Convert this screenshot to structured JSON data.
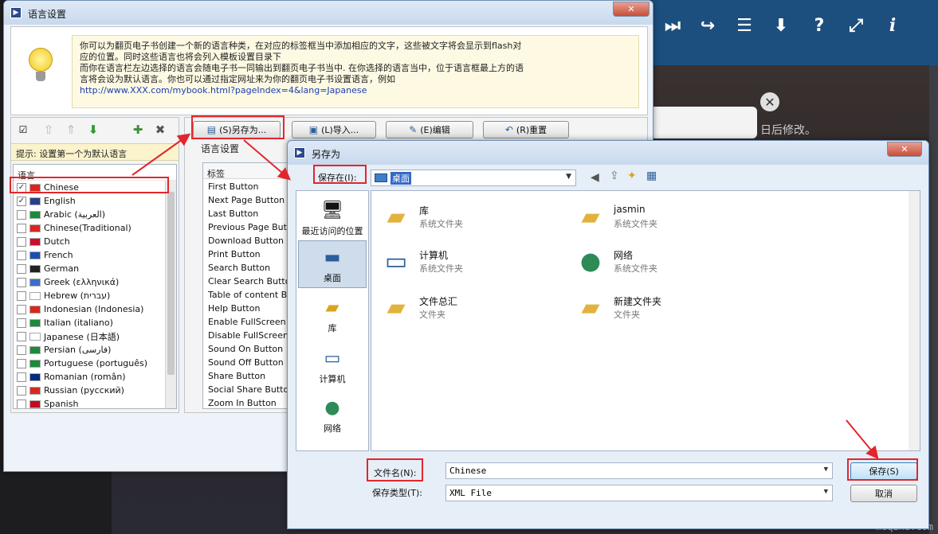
{
  "background_app": {
    "toolbar_icons": [
      "forward-icon",
      "share-icon",
      "list-icon",
      "download-icon",
      "help-icon",
      "fullscreen-icon",
      "info-icon"
    ],
    "popup_text": "日后修改。",
    "watermark": "muqina.com"
  },
  "lang_window": {
    "title": "语言设置",
    "info_text": "你可以为翻页电子书创建一个新的语言种类，在对应的标签框当中添加相应的文字，这些被文字将会显示到flash对\n应的位置。同时这些语言也将会列入模板设置目录下\n而你在语言栏左边选择的语言会随电子书一同输出到翻页电子书当中. 在你选择的语言当中，位于语言框最上方的语\n言将会设为默认语言。你也可以通过指定网址来为你的翻页电子书设置语言，例如",
    "info_link": "http://www.XXX.com/mybook.html?pageIndex=4&lang=Japanese",
    "hint": "提示: 设置第一个为默认语言",
    "list_header": "语言",
    "languages": [
      {
        "name": "Chinese",
        "checked": true
      },
      {
        "name": "English",
        "checked": true
      },
      {
        "name": "Arabic (العربية)",
        "checked": false
      },
      {
        "name": "Chinese(Traditional)",
        "checked": false
      },
      {
        "name": "Dutch",
        "checked": false
      },
      {
        "name": "French",
        "checked": false
      },
      {
        "name": "German",
        "checked": false
      },
      {
        "name": "Greek (ελληνικά)",
        "checked": false
      },
      {
        "name": "Hebrew (עברית)",
        "checked": false
      },
      {
        "name": "Indonesian (Indonesia)",
        "checked": false
      },
      {
        "name": "Italian (italiano)",
        "checked": false
      },
      {
        "name": "Japanese (日本語)",
        "checked": false
      },
      {
        "name": "Persian (فارسی)",
        "checked": false
      },
      {
        "name": "Portuguese (português)",
        "checked": false
      },
      {
        "name": "Romanian (român)",
        "checked": false
      },
      {
        "name": "Russian (русский)",
        "checked": false
      },
      {
        "name": "Spanish",
        "checked": false
      }
    ],
    "buttons": {
      "save_as": "(S)另存为...",
      "import": "(L)导入...",
      "edit": "(E)编辑",
      "reset": "(R)重置"
    },
    "panel_title": "语言设置",
    "label_header": "标签",
    "labels": [
      "First Button",
      "Next Page Button",
      "Last Button",
      "Previous Page Button",
      "Download Button",
      "Print Button",
      "Search Button",
      "Clear Search Button",
      "Table of content Butt",
      "Help Button",
      "Enable FullScreen But",
      "Disable FullScreen Bu",
      "Sound On Button",
      "Sound Off Button",
      "Share Button",
      "Social Share Button",
      "Zoom In Button"
    ]
  },
  "save_dialog": {
    "title": "另存为",
    "save_in_label": "保存在(I):",
    "save_in_value": "桌面",
    "places": [
      "最近访问的位置",
      "桌面",
      "库",
      "计算机",
      "网络"
    ],
    "files": [
      {
        "name": "库",
        "type": "系统文件夹"
      },
      {
        "name": "jasmin",
        "type": "系统文件夹"
      },
      {
        "name": "计算机",
        "type": "系统文件夹"
      },
      {
        "name": "网络",
        "type": "系统文件夹"
      },
      {
        "name": "文件总汇",
        "type": "文件夹"
      },
      {
        "name": "新建文件夹",
        "type": "文件夹"
      }
    ],
    "filename_label": "文件名(N):",
    "filename_value": "Chinese",
    "filetype_label": "保存类型(T):",
    "filetype_value": "XML File",
    "save_button": "保存(S)",
    "cancel_button": "取消"
  },
  "colors": {
    "highlight": "#e3262b",
    "toolbar_bg": "#1c4f7e"
  }
}
